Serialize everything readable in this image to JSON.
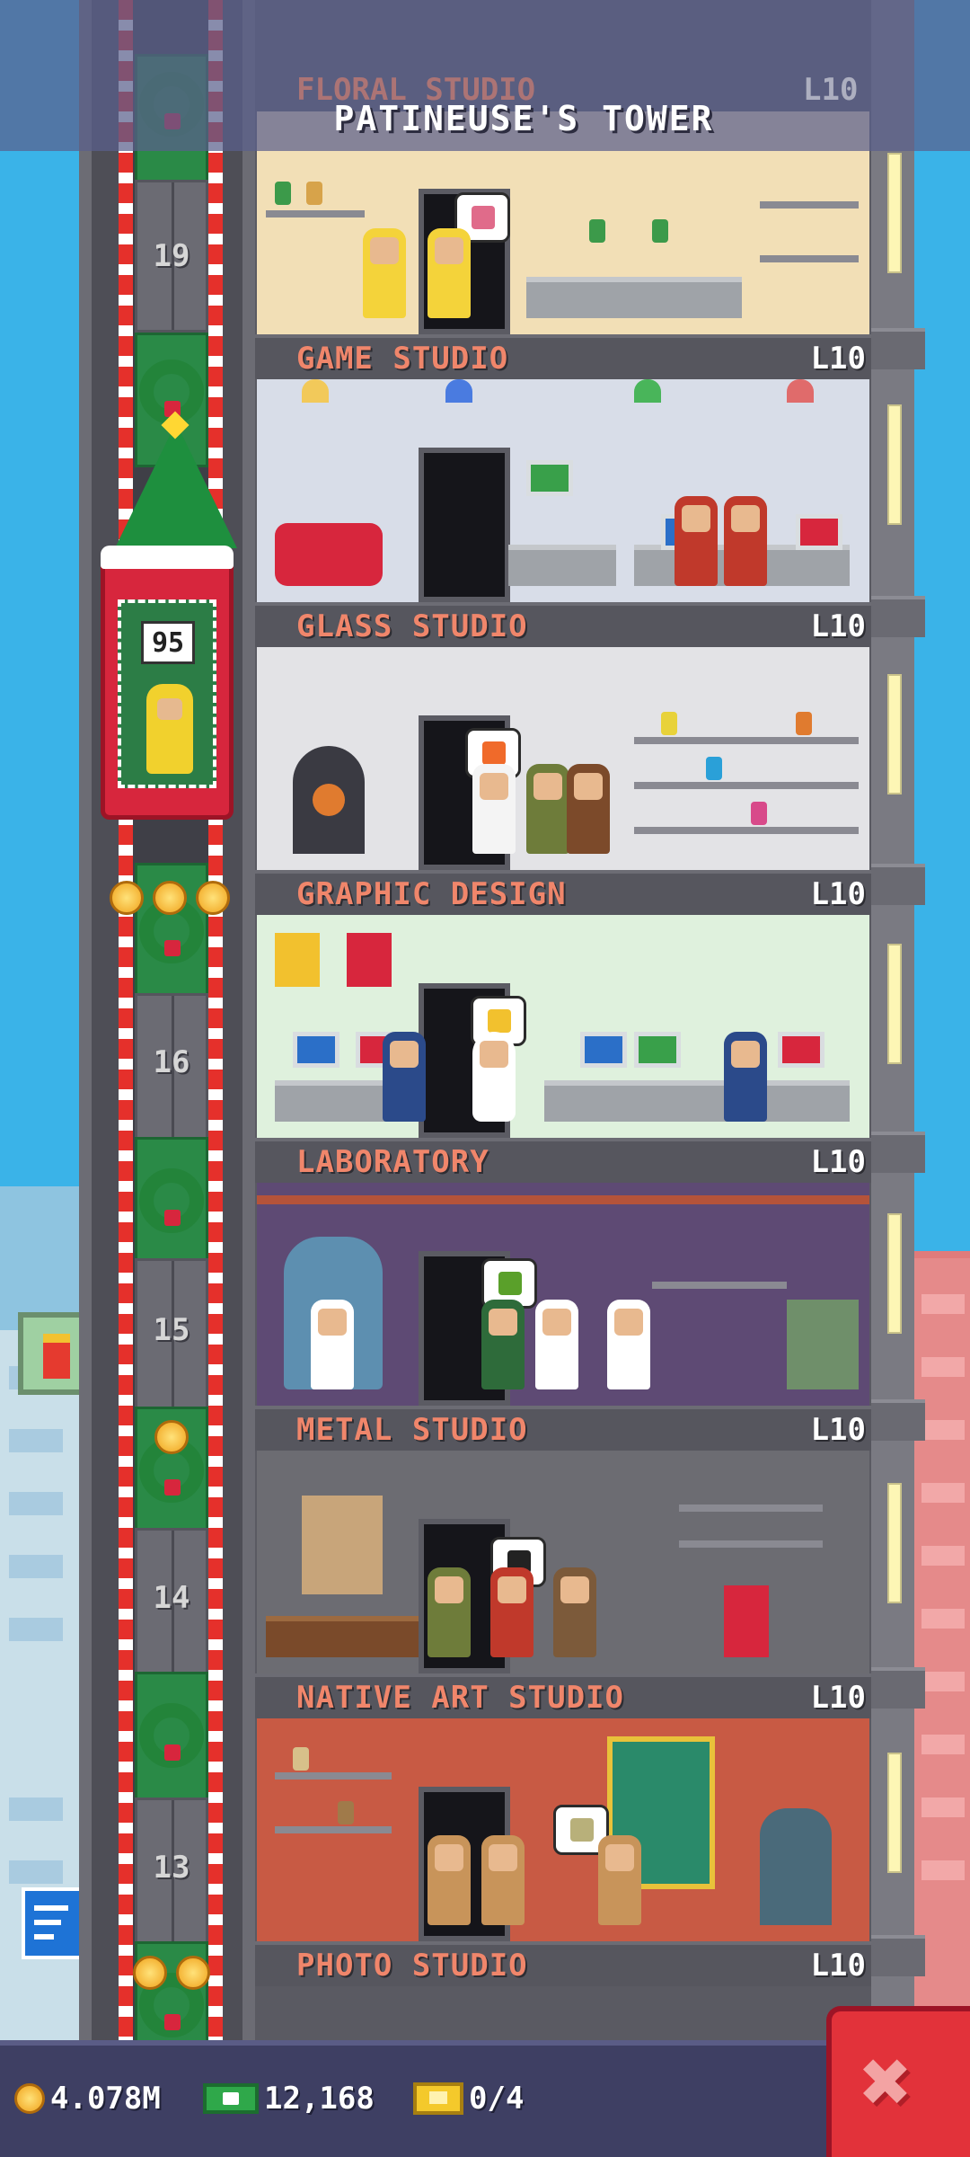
{
  "header": {
    "title": "PATINEUSE'S TOWER",
    "ghost_floor_name": "FLORAL STUDIO",
    "ghost_floor_level": "L10"
  },
  "elevator": {
    "sign_value": "95"
  },
  "shaft": {
    "floor_numbers": [
      "19",
      "16",
      "15",
      "14",
      "13"
    ]
  },
  "floors": [
    {
      "name": "GAME STUDIO",
      "level": "L10",
      "wall": "#f2dfb6"
    },
    {
      "name": "GLASS STUDIO",
      "level": "L10",
      "wall": "#d8dde8"
    },
    {
      "name": "GRAPHIC DESIGN",
      "level": "L10",
      "wall": "#e3e3e6"
    },
    {
      "name": "LABORATORY",
      "level": "L10",
      "wall": "#dff1dd"
    },
    {
      "name": "METAL STUDIO",
      "level": "L10",
      "wall": "#5e4a74"
    },
    {
      "name": "NATIVE ART STUDIO",
      "level": "L10",
      "wall": "#6c6c72"
    },
    {
      "name": "PHOTO STUDIO",
      "level": "L10",
      "wall": "#c85a44"
    }
  ],
  "resources": {
    "coins": "4.078M",
    "bux": "12,168",
    "tickets": "0/4",
    "coin_icon": "coin-icon",
    "bux_icon": "bux-icon",
    "ticket_icon": "golden-ticket-icon"
  },
  "close_button": {
    "label": "✖",
    "color": "#e2323a"
  }
}
